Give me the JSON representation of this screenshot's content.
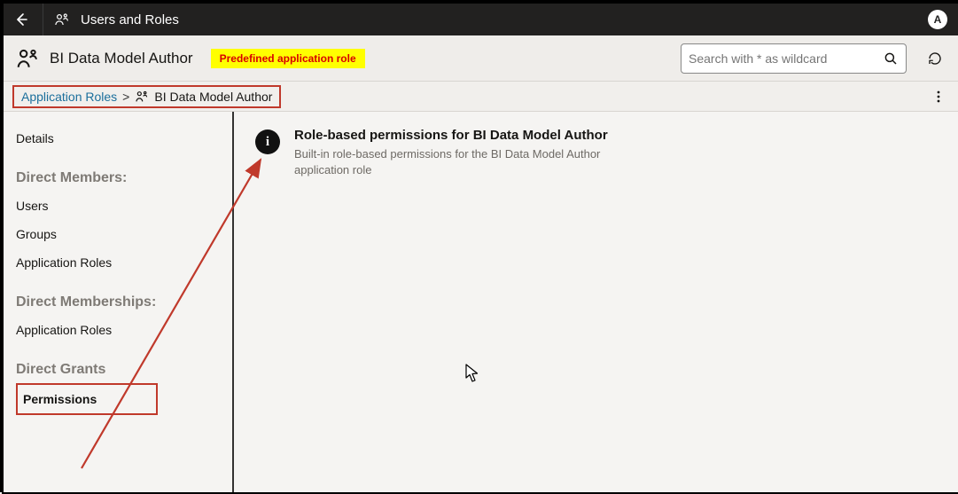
{
  "topbar": {
    "title": "Users and Roles",
    "avatar_initial": "A"
  },
  "subbar": {
    "role_name": "BI Data Model Author",
    "badge": "Predefined application role",
    "search_placeholder": "Search with * as wildcard"
  },
  "breadcrumb": {
    "root": "Application Roles",
    "separator": ">",
    "current": "BI Data Model Author"
  },
  "sidenav": {
    "details": "Details",
    "section_members": "Direct Members:",
    "users": "Users",
    "groups": "Groups",
    "app_roles_members": "Application Roles",
    "section_memberships": "Direct Memberships:",
    "app_roles_memberships": "Application Roles",
    "section_grants": "Direct Grants",
    "permissions": "Permissions"
  },
  "main": {
    "info_icon_letter": "i",
    "heading": "Role-based permissions for BI Data Model Author",
    "description": "Built-in role-based permissions for the BI Data Model Author application role"
  },
  "annotations": {
    "highlight_color": "#c0392b",
    "badge_bg": "#ffff00",
    "badge_fg": "#d80000"
  }
}
